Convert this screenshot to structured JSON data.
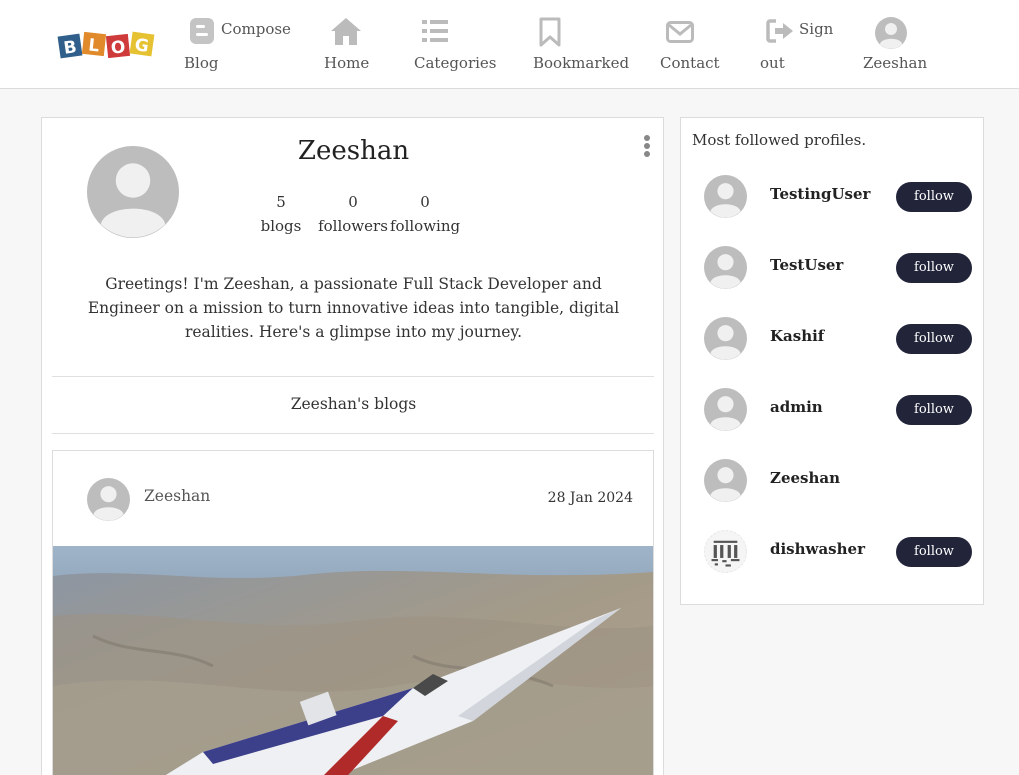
{
  "nav": {
    "logo_text": "BLOG",
    "compose": {
      "line1": "Compose",
      "line2": "Blog"
    },
    "home": "Home",
    "categories": "Categories",
    "bookmarked": "Bookmarked",
    "contact": "Contact",
    "signout": {
      "line1": "Sign",
      "line2": "out"
    },
    "user": "Zeeshan"
  },
  "profile": {
    "name": "Zeeshan",
    "stats": [
      {
        "count": "5",
        "label": "blogs"
      },
      {
        "count": "0",
        "label": "followers"
      },
      {
        "count": "0",
        "label": "following"
      }
    ],
    "bio": "Greetings! I'm Zeeshan, a passionate Full Stack Developer and Engineer on a mission to turn innovative ideas into tangible, digital realities. Here's a glimpse into my journey.",
    "blogs_heading": "Zeeshan's blogs"
  },
  "post": {
    "author": "Zeeshan",
    "date": "28 Jan 2024"
  },
  "sidebar": {
    "title": "Most followed profiles.",
    "profiles": [
      {
        "name": "TestingUser",
        "action": "follow"
      },
      {
        "name": "TestUser",
        "action": "follow"
      },
      {
        "name": "Kashif",
        "action": "follow"
      },
      {
        "name": "admin",
        "action": "follow"
      },
      {
        "name": "Zeeshan",
        "action": ""
      },
      {
        "name": "dishwasher",
        "action": "follow"
      }
    ]
  },
  "colors": {
    "accent": "#22253a",
    "icon_gray": "#bbbbbb",
    "avatar_gray": "#c4c4c4"
  }
}
